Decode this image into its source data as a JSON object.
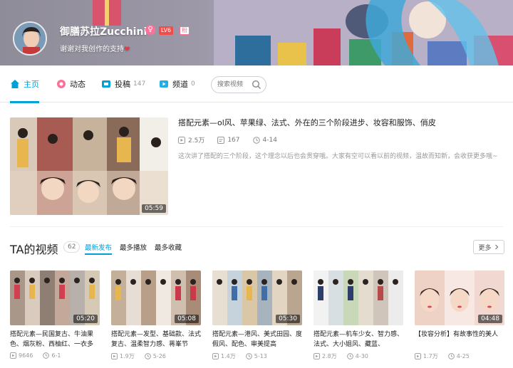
{
  "profile": {
    "username": "御膳苏拉Zucchini",
    "gender_symbol": "♀",
    "level_badge": "LV6",
    "fan_badge": "粉",
    "sign": "谢谢对我创作的支持",
    "heart": "❤"
  },
  "nav": {
    "tabs": [
      {
        "label": "主页",
        "count": "",
        "icon": "home-icon",
        "active": true
      },
      {
        "label": "动态",
        "count": "",
        "icon": "flower-icon",
        "active": false
      },
      {
        "label": "投稿",
        "count": "147",
        "icon": "upload-icon",
        "active": false
      },
      {
        "label": "频道",
        "count": "0",
        "icon": "channel-icon",
        "active": false
      }
    ],
    "search_placeholder": "搜索视频"
  },
  "featured": {
    "title": "搭配元素—ol风、苹果绿、法式、外在的三个阶段进步、妆容和服饰、俏皮",
    "views": "2.5万",
    "comments": "167",
    "date": "4-14",
    "description": "这次讲了搭配的三个阶段，这个理念以后也会贯穿哦。大家有空可以看以前的视频，温故而知新，会收获更多哦~",
    "duration": "05:59"
  },
  "videos_section": {
    "title": "TA的视频",
    "count": "62",
    "sort_options": [
      "最新发布",
      "最多播放",
      "最多收藏"
    ],
    "more_label": "更多"
  },
  "videos": [
    {
      "title": "搭配元素—民国复古、牛油果色、烟灰粉、西柚红、一衣多",
      "views": "9646",
      "date": "6-1",
      "duration": "05:20"
    },
    {
      "title": "搭配元素—发型、基础款、法式复古、温柔智力感、蒋峯节",
      "views": "1.9万",
      "date": "5-26",
      "duration": "05:08"
    },
    {
      "title": "搭配元素—港风、美式田园、度假风、配色、审美提高",
      "views": "1.4万",
      "date": "5-13",
      "duration": "05:30"
    },
    {
      "title": "搭配元素—机车少女、智力感、法式、大小姐风、藏蓝、",
      "views": "2.8万",
      "date": "4-30",
      "duration": ""
    },
    {
      "title": "【妆容分析】有故事性的美人",
      "views": "1.7万",
      "date": "4-25",
      "duration": "04:48"
    }
  ],
  "colors": {
    "accent": "#00a1d6",
    "pink": "#fb7299",
    "level_red": "#f04c49"
  }
}
